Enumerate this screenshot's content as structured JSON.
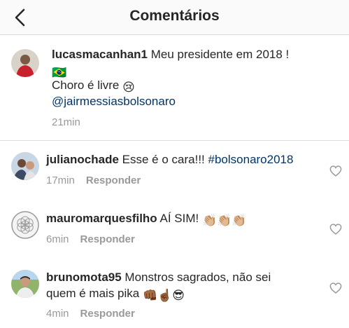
{
  "header": {
    "title": "Comentários"
  },
  "caption": {
    "username": "lucasmacanhan1",
    "text_line1": "Meu presidente em 2018 !",
    "flag": "🇧🇷",
    "text_line3": "Choro é livre",
    "crying_emoji": "😢",
    "mention": "@jairmessiasbolsonaro",
    "time": "21min"
  },
  "comments": [
    {
      "username": "julianochade",
      "text": "Esse é o cara!!!",
      "hashtag": "#bolsonaro2018",
      "time": "17min",
      "reply_label": "Responder"
    },
    {
      "username": "mauromarquesfilho",
      "text": "AÍ SIM!",
      "emoji": "👏🏼👏🏼👏🏼",
      "time": "6min",
      "reply_label": "Responder"
    },
    {
      "username": "brunomota95",
      "text": "Monstros sagrados, não sei",
      "text_line2": "quem é mais pika",
      "emoji": "👊🏾☝🏾😎",
      "time": "4min",
      "reply_label": "Responder"
    }
  ],
  "colors": {
    "link": "#003569",
    "meta": "#999999",
    "divider": "#dbdbdb"
  },
  "icons": {
    "back": "chevron-left-icon",
    "like": "heart-outline-icon"
  }
}
